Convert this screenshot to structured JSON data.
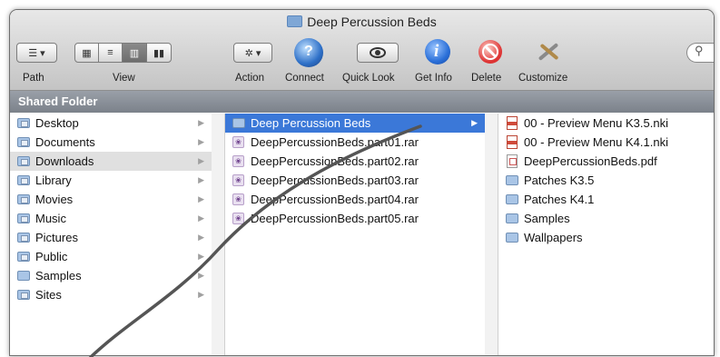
{
  "window": {
    "title": "Deep Percussion Beds"
  },
  "toolbar": {
    "labels": {
      "path": "Path",
      "view": "View",
      "action": "Action",
      "connect": "Connect",
      "quick_look": "Quick Look",
      "get_info": "Get Info",
      "delete": "Delete",
      "customize": "Customize"
    },
    "path_menu_glyph": "☰ ▾",
    "action_menu_glyph": "✲ ▾",
    "search_glyph": "🔍"
  },
  "sidebar_header": "Shared Folder",
  "columns": {
    "places": [
      {
        "label": "Desktop",
        "icon": "folder-desktop-icon"
      },
      {
        "label": "Documents",
        "icon": "folder-documents-icon"
      },
      {
        "label": "Downloads",
        "icon": "folder-downloads-icon"
      },
      {
        "label": "Library",
        "icon": "folder-library-icon"
      },
      {
        "label": "Movies",
        "icon": "folder-movies-icon"
      },
      {
        "label": "Music",
        "icon": "folder-music-icon"
      },
      {
        "label": "Pictures",
        "icon": "folder-pictures-icon"
      },
      {
        "label": "Public",
        "icon": "folder-public-icon"
      },
      {
        "label": "Samples",
        "icon": "folder-icon"
      },
      {
        "label": "Sites",
        "icon": "folder-sites-icon"
      }
    ],
    "downloads": [
      {
        "label": "Deep Percussion Beds",
        "icon": "folder-icon"
      },
      {
        "label": "DeepPercussionBeds.part01.rar",
        "icon": "rar-archive-icon"
      },
      {
        "label": "DeepPercussionBeds.part02.rar",
        "icon": "rar-archive-icon"
      },
      {
        "label": "DeepPercussionBeds.part03.rar",
        "icon": "rar-archive-icon"
      },
      {
        "label": "DeepPercussionBeds.part04.rar",
        "icon": "rar-archive-icon"
      },
      {
        "label": "DeepPercussionBeds.part05.rar",
        "icon": "rar-archive-icon"
      }
    ],
    "contents": [
      {
        "label": "00 - Preview Menu K3.5.nki",
        "icon": "nki-file-icon"
      },
      {
        "label": "00 - Preview Menu K4.1.nki",
        "icon": "nki-file-icon"
      },
      {
        "label": "DeepPercussionBeds.pdf",
        "icon": "pdf-file-icon"
      },
      {
        "label": "Patches K3.5",
        "icon": "folder-icon"
      },
      {
        "label": "Patches K4.1",
        "icon": "folder-icon"
      },
      {
        "label": "Samples",
        "icon": "folder-icon"
      },
      {
        "label": "Wallpapers",
        "icon": "folder-icon"
      }
    ]
  },
  "colors": {
    "selection": "#3b78d8",
    "highlight": "#e0e0e0",
    "info_blue": "#2a6fd8",
    "delete_red": "#d33"
  }
}
